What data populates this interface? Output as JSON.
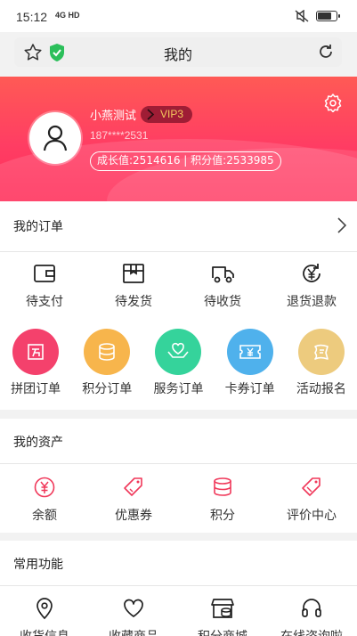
{
  "status": {
    "time": "15:12",
    "network": "4G HD"
  },
  "urlbar": {
    "title": "我的"
  },
  "profile": {
    "name": "小燕测试",
    "vip": "VIP3",
    "phone": "187****2531",
    "stats": "成长值:2514616 | 积分值:2533985"
  },
  "orders": {
    "title": "我的订单",
    "items": [
      {
        "label": "待支付",
        "icon": "wallet-icon"
      },
      {
        "label": "待发货",
        "icon": "box-icon"
      },
      {
        "label": "待收货",
        "icon": "truck-icon"
      },
      {
        "label": "退货退款",
        "icon": "refund-icon"
      }
    ],
    "special": [
      {
        "label": "拼团订单",
        "icon": "group-buy-icon",
        "color": "#f4416c"
      },
      {
        "label": "积分订单",
        "icon": "coins-icon",
        "color": "#f7b54c"
      },
      {
        "label": "服务订单",
        "icon": "heart-hands-icon",
        "color": "#35d39b"
      },
      {
        "label": "卡券订单",
        "icon": "ticket-icon",
        "color": "#4fb1ec"
      },
      {
        "label": "活动报名",
        "icon": "flag-icon",
        "color": "#edcb7e"
      }
    ]
  },
  "assets": {
    "title": "我的资产",
    "items": [
      {
        "label": "余额",
        "icon": "yen-circle-icon"
      },
      {
        "label": "优惠券",
        "icon": "coupon-tag-icon"
      },
      {
        "label": "积分",
        "icon": "points-stack-icon"
      },
      {
        "label": "评价中心",
        "icon": "review-tag-icon"
      }
    ]
  },
  "common": {
    "title": "常用功能",
    "items": [
      {
        "label": "收货信息",
        "icon": "location-pin-icon"
      },
      {
        "label": "收藏商品",
        "icon": "heart-icon"
      },
      {
        "label": "积分商城",
        "icon": "store-icon"
      },
      {
        "label": "在线咨询啦",
        "icon": "headset-icon"
      }
    ]
  },
  "colors": {
    "accent": "#f0385a",
    "banner_top": "#ff5a55",
    "banner_bottom": "#ff2f5b"
  }
}
